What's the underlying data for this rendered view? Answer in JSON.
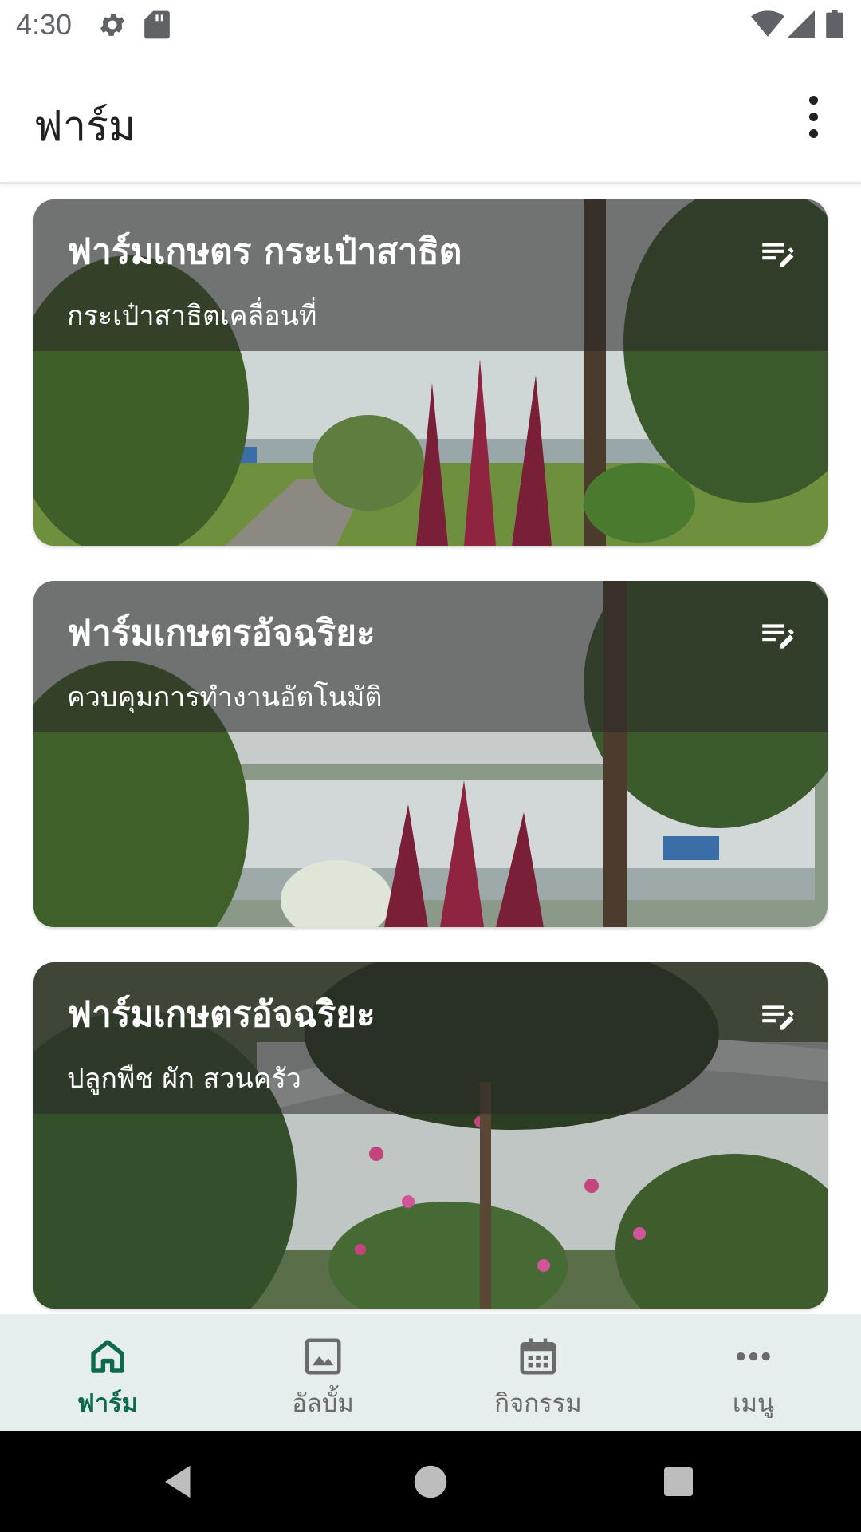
{
  "status_bar": {
    "time": "4:30",
    "left_icons": [
      "settings-icon",
      "sd-card-icon"
    ],
    "right_icons": [
      "wifi-icon",
      "cellular-signal-icon",
      "battery-icon"
    ]
  },
  "app_bar": {
    "title": "ฟาร์ม",
    "overflow_icon": "more-vertical-icon"
  },
  "farms": [
    {
      "title": "ฟาร์มเกษตร กระเป๋าสาธิต",
      "subtitle": "กระเป๋าสาธิตเคลื่อนที่",
      "action_icon": "edit-note-icon",
      "scene": "greenhouse-garden"
    },
    {
      "title": "ฟาร์มเกษตรอัจฉริยะ",
      "subtitle": "ควบคุมการทำงานอัตโนมัติ",
      "action_icon": "edit-note-icon",
      "scene": "greenhouse-garden"
    },
    {
      "title": "ฟาร์มเกษตรอัจฉริยะ",
      "subtitle": "ปลูกพืช ผัก สวนครัว",
      "action_icon": "edit-note-icon",
      "scene": "flowering-shrubs"
    }
  ],
  "bottom_nav": {
    "items": [
      {
        "label": "ฟาร์ม",
        "icon": "home-icon",
        "active": true
      },
      {
        "label": "อัลบั้ม",
        "icon": "image-icon",
        "active": false
      },
      {
        "label": "กิจกรรม",
        "icon": "calendar-icon",
        "active": false
      },
      {
        "label": "เมนู",
        "icon": "more-horizontal-icon",
        "active": false
      }
    ]
  },
  "system_nav": {
    "items": [
      "back-icon",
      "home-circle-icon",
      "recents-icon"
    ]
  },
  "colors": {
    "accent": "#0e6a4d",
    "bottom_nav_bg": "#e5eeec",
    "inactive": "#6b6b6b"
  }
}
